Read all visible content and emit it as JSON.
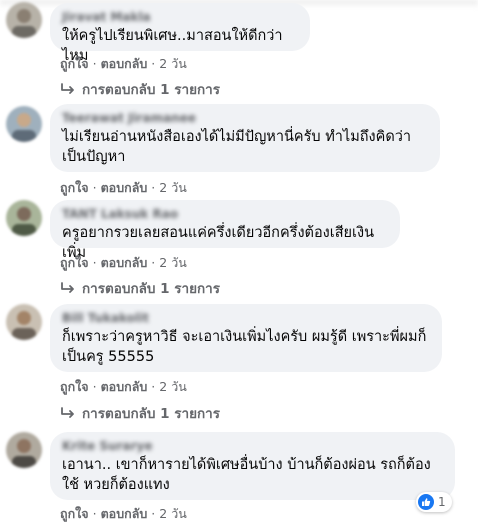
{
  "actions": {
    "like": "ถูกใจ",
    "reply": "ตอบกลับ",
    "separator": "·"
  },
  "reply_arrow_icon": "reply-arrow-icon",
  "comments": [
    {
      "author": "Jiravat Makla",
      "text": "ให้ครูไปเรียนพิเศษ..มาสอนให้ดีกว่าไหม",
      "time": "2 วัน",
      "replies": "การตอบกลับ 1 รายการ"
    },
    {
      "author": "Teerawat Jiramanee",
      "text": "ไม่เรียนอ่านหนังสือเองได้ไม่มีปัญหานี่ครับ ทำไมถึงคิดว่าเป็นปัญหา",
      "time": "2 วัน"
    },
    {
      "author": "TANT Laksuk Rao",
      "text": "ครูอยากรวยเลยสอนแค่ครึ่งเดียวอีกครึ่งต้องเสียเงินเพิ่ม",
      "time": "2 วัน",
      "replies": "การตอบกลับ 1 รายการ"
    },
    {
      "author": "Bill Tukakolit",
      "text": "ก็เพราะว่าครูหาวิธี จะเอาเงินเพิ่มไงครับ ผมรู้ดี เพราะพี่ผมก็เป็นครู 55555",
      "time": "2 วัน",
      "replies": "การตอบกลับ 1 รายการ"
    },
    {
      "author": "Krite Surarye",
      "text": "เอานา.. เขาก็หารายได้พิเศษอื่นบ้าง บ้านก็ต้องผ่อน รถก็ต้องใช้ หวยก็ต้องแทง",
      "time": "2 วัน",
      "reaction_count": "1"
    }
  ],
  "colors": {
    "bubble": "#f0f2f5",
    "meta_text": "#65676b",
    "like_blue": "#1877f2"
  }
}
